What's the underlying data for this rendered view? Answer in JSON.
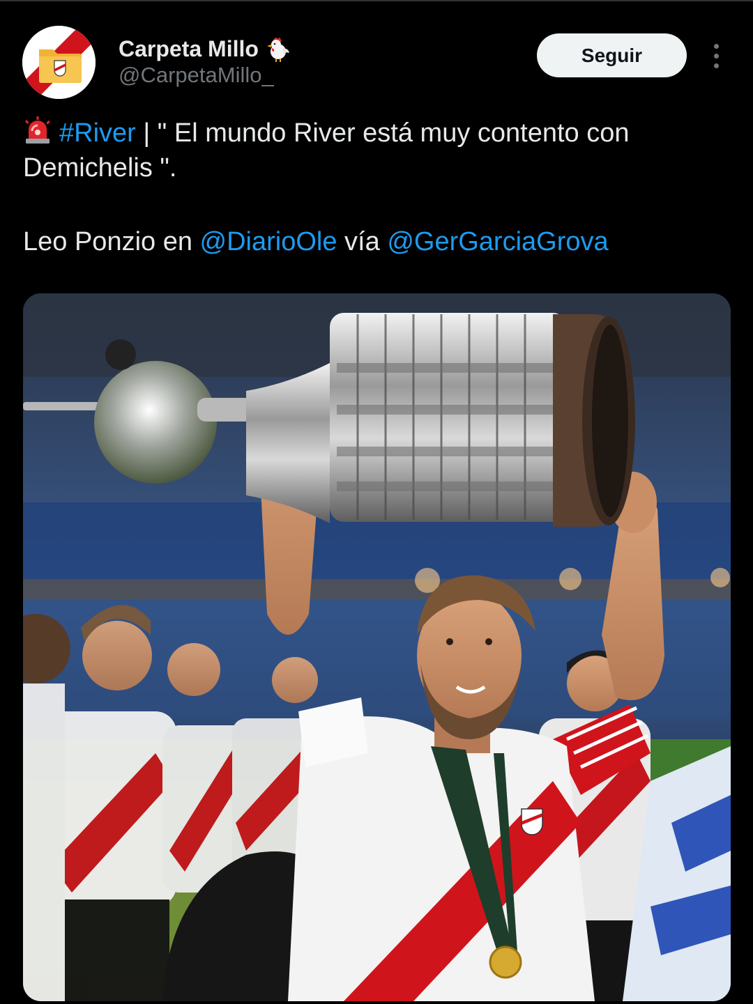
{
  "author": {
    "display_name": "Carpeta Millo",
    "handle": "@CarpetaMillo_",
    "name_emoji": "rooster-emoji",
    "avatar_icon": "folder-river-crest-icon"
  },
  "actions": {
    "follow_label": "Seguir",
    "more_icon": "more-dots-icon"
  },
  "tweet": {
    "line1": {
      "emoji": "siren-emoji",
      "hashtag": "#River",
      "text_after_hashtag": " | \" El mundo River está muy contento con",
      "continuation": "Demichelis \"."
    },
    "line2": {
      "text_before": "Leo Ponzio en ",
      "mention1": "@DiarioOle",
      "text_middle": " vía ",
      "mention2": "@GerGarciaGrova"
    }
  },
  "media": {
    "kind": "photo",
    "subject": "player-lifting-trophy"
  },
  "colors": {
    "background": "#000000",
    "text": "#e7e9ea",
    "muted": "#71767b",
    "link": "#1d9bf0",
    "button_bg": "#eff3f4",
    "river_red": "#d0141c"
  }
}
